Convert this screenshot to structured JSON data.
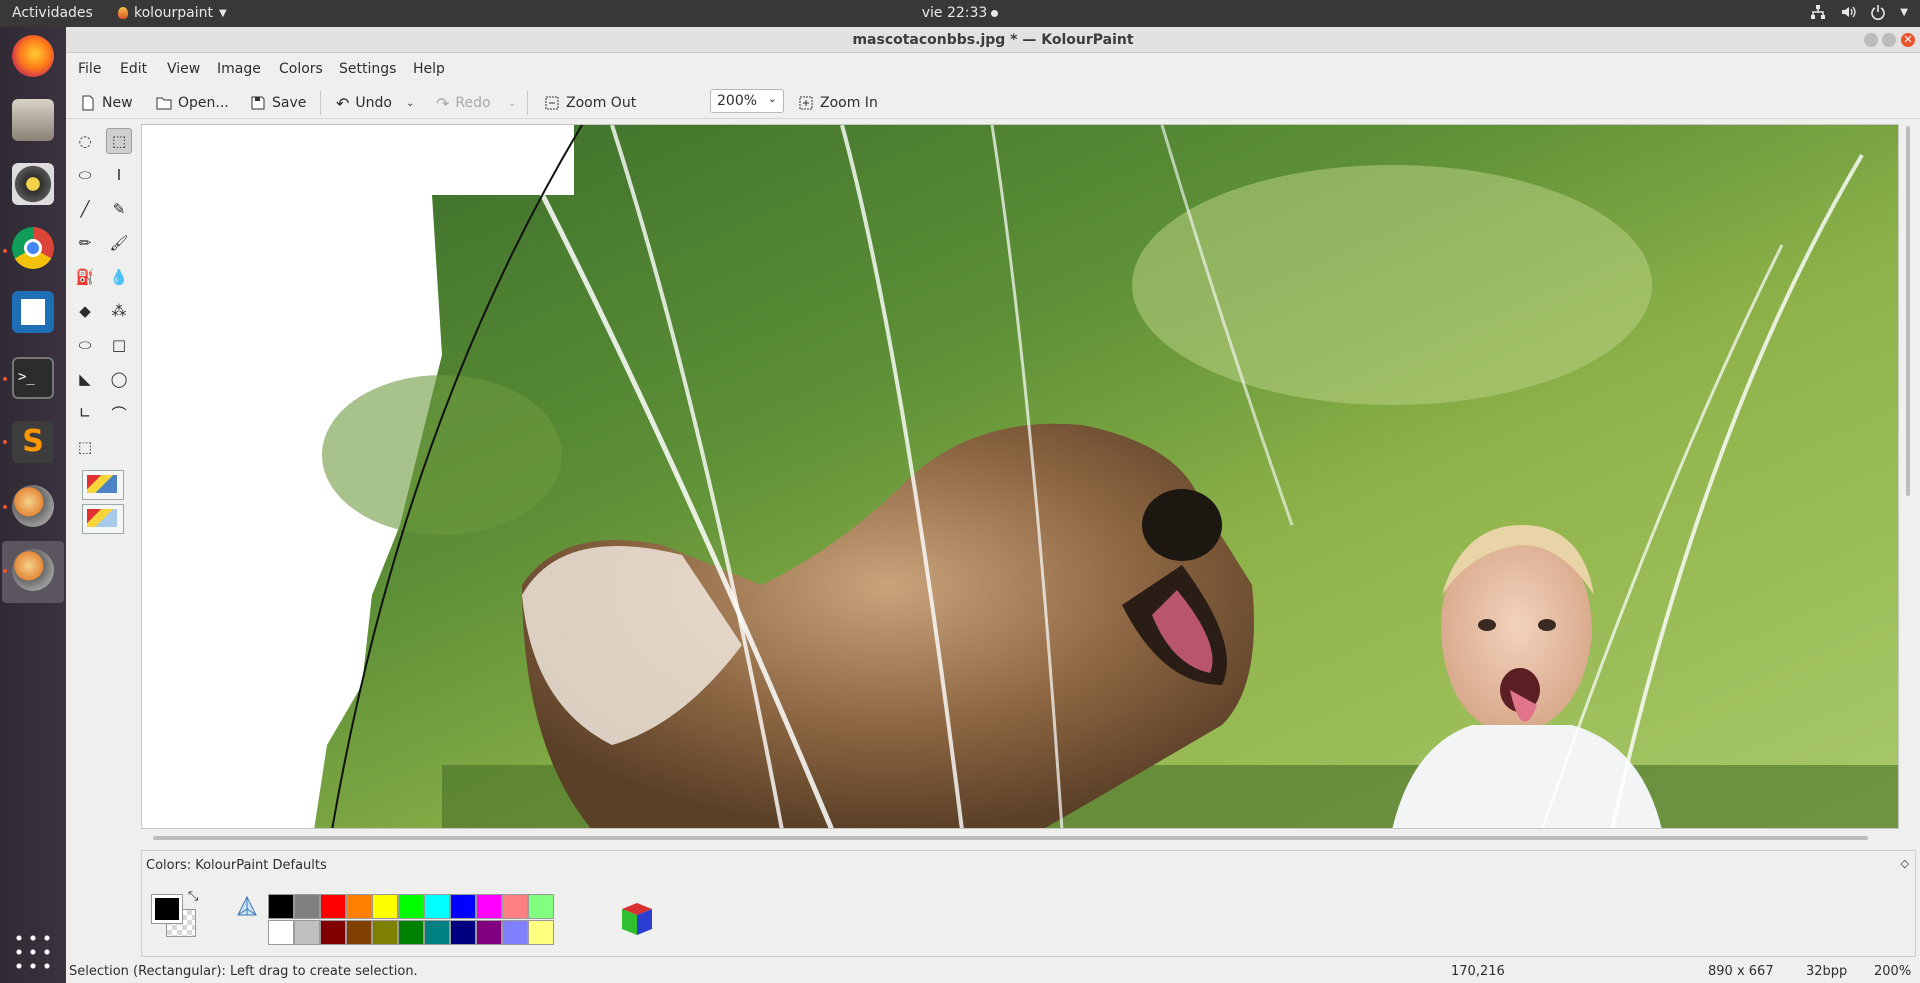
{
  "topbar": {
    "activities": "Actividades",
    "app_menu": "kolourpaint",
    "clock": "vie 22:33"
  },
  "window": {
    "title": "mascotaconbbs.jpg * — KolourPaint"
  },
  "menu": [
    "File",
    "Edit",
    "View",
    "Image",
    "Colors",
    "Settings",
    "Help"
  ],
  "toolbar": {
    "new": "New",
    "open": "Open...",
    "save": "Save",
    "undo": "Undo",
    "redo": "Redo",
    "zoom_out": "Zoom Out",
    "zoom_value": "200%",
    "zoom_in": "Zoom In"
  },
  "tools": [
    "free-form-selection",
    "rectangular-selection",
    "elliptical-selection",
    "text",
    "line",
    "color-picker",
    "pen",
    "brush",
    "flood-fill",
    "color-eraser",
    "eraser",
    "spraycan",
    "ellipse",
    "rectangle",
    "polygon",
    "ellipse-2",
    "polyline",
    "curve",
    "resize"
  ],
  "colors": {
    "panel_title": "Colors: KolourPaint Defaults",
    "foreground": "#000000",
    "background": "#ffffff",
    "palette_top": [
      "#000000",
      "#808080",
      "#ff0000",
      "#ff8000",
      "#ffff00",
      "#00ff00",
      "#00ffff",
      "#0000ff",
      "#ff00ff",
      "#ff8080",
      "#80ff80"
    ],
    "palette_bottom": [
      "#ffffff",
      "#c0c0c0",
      "#800000",
      "#804000",
      "#808000",
      "#008000",
      "#008080",
      "#000080",
      "#800080",
      "#8080ff",
      "#ffff80"
    ]
  },
  "status": {
    "message": "Selection (Rectangular): Left drag to create selection.",
    "coords": "170,216",
    "dimensions": "890 x 667",
    "depth": "32bpp",
    "zoom": "200%"
  }
}
